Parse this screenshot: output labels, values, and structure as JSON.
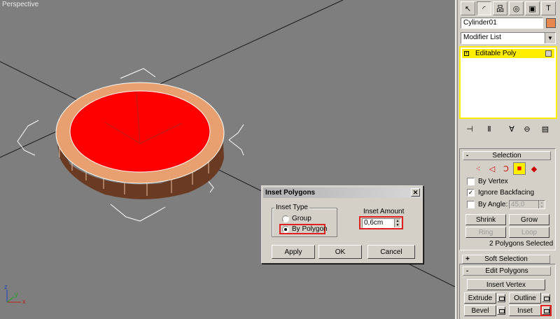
{
  "viewport": {
    "label": "Perspective",
    "colors": {
      "background": "#7e7e7e",
      "selected_face": "#ff0000",
      "side": "#e8a070"
    }
  },
  "command_panel": {
    "tabs": [
      {
        "icon": "create-icon",
        "glyph": "↖"
      },
      {
        "icon": "modify-icon",
        "glyph": "◜",
        "active": true
      },
      {
        "icon": "hierarchy-icon",
        "glyph": "品"
      },
      {
        "icon": "motion-icon",
        "glyph": "◎"
      },
      {
        "icon": "display-icon",
        "glyph": "▣"
      },
      {
        "icon": "utilities-icon",
        "glyph": "T"
      }
    ],
    "object_name": "Cylinder01",
    "object_color": "#e8874e",
    "modifier_list": "Modifier List",
    "stack": [
      {
        "label": "Editable Poly",
        "expand_sign": "+"
      }
    ],
    "stack_tools": [
      {
        "icon": "pin-stack-icon",
        "glyph": "⊣"
      },
      {
        "icon": "show-end-result-icon",
        "glyph": "Ⅱ"
      },
      {
        "icon": "make-unique-icon",
        "glyph": "∀"
      },
      {
        "icon": "remove-modifier-icon",
        "glyph": "⊖"
      },
      {
        "icon": "configure-modifier-sets-icon",
        "glyph": "▤"
      }
    ],
    "selection": {
      "title": "Selection",
      "sign": "-",
      "subobjects": [
        {
          "icon": "vertex-icon",
          "glyph": "⁖"
        },
        {
          "icon": "edge-icon",
          "glyph": "◁"
        },
        {
          "icon": "border-icon",
          "glyph": "Ↄ"
        },
        {
          "icon": "polygon-icon",
          "glyph": "■",
          "active": true
        },
        {
          "icon": "element-icon",
          "glyph": "◆"
        }
      ],
      "by_vertex": {
        "label": "By Vertex",
        "checked": false
      },
      "ignore_backfacing": {
        "label": "Ignore Backfacing",
        "checked": true
      },
      "by_angle": {
        "label": "By Angle:",
        "checked": false,
        "value": "45,0"
      },
      "shrink": "Shrink",
      "grow": "Grow",
      "ring": "Ring",
      "loop": "Loop",
      "status": "2 Polygons Selected"
    },
    "soft_selection": {
      "title": "Soft Selection",
      "sign": "+"
    },
    "edit_polygons": {
      "title": "Edit Polygons",
      "sign": "-",
      "insert_vertex": "Insert Vertex",
      "extrude": "Extrude",
      "outline": "Outline",
      "bevel": "Bevel",
      "inset": "Inset"
    }
  },
  "dialog": {
    "title": "Inset Polygons",
    "close_glyph": "✕",
    "inset_type_label": "Inset Type",
    "options": [
      {
        "label": "Group",
        "selected": false
      },
      {
        "label": "By Polygon",
        "selected": true
      }
    ],
    "inset_amount_label": "Inset Amount",
    "inset_amount_value": "0,6cm",
    "apply": "Apply",
    "ok": "OK",
    "cancel": "Cancel"
  },
  "axis_tripod": {
    "x": "x",
    "y": "y",
    "z": "z"
  }
}
